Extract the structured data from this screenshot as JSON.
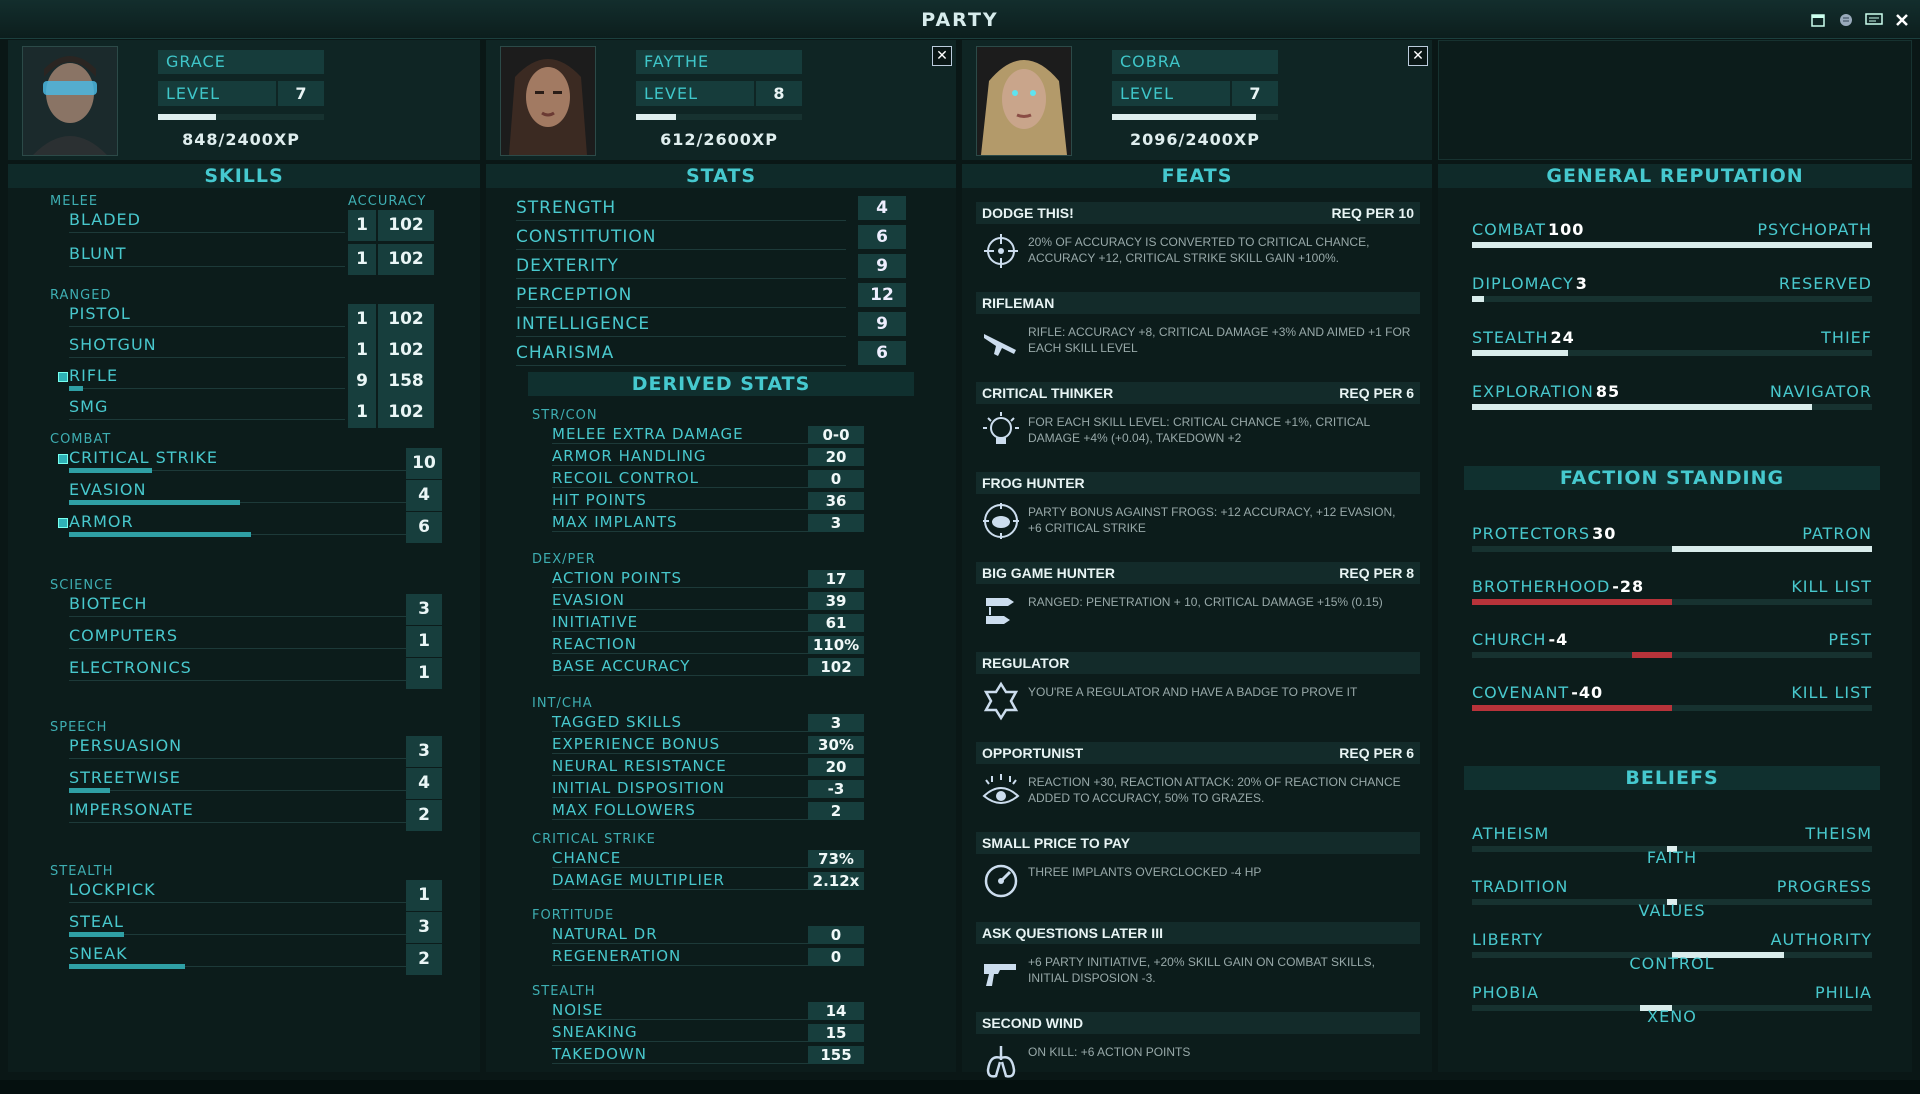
{
  "window": {
    "title": "PARTY"
  },
  "characters": [
    {
      "name": "GRACE",
      "level_label": "LEVEL",
      "level": "7",
      "xp_text": "848/2400XP",
      "xp_progress": 0.35
    },
    {
      "name": "FAYTHE",
      "level_label": "LEVEL",
      "level": "8",
      "xp_text": "612/2600XP",
      "xp_progress": 0.24
    },
    {
      "name": "COBRA",
      "level_label": "LEVEL",
      "level": "7",
      "xp_text": "2096/2400XP",
      "xp_progress": 0.87
    }
  ],
  "skills": {
    "title": "SKILLS",
    "accuracy_label": "ACCURACY",
    "groups": [
      {
        "label": "MELEE",
        "items": [
          {
            "name": "BLADED",
            "rank": "1",
            "accuracy": "102",
            "tagged": false,
            "progress": 0
          },
          {
            "name": "BLUNT",
            "rank": "1",
            "accuracy": "102",
            "tagged": false,
            "progress": 0
          }
        ]
      },
      {
        "label": "RANGED",
        "items": [
          {
            "name": "PISTOL",
            "rank": "1",
            "accuracy": "102",
            "tagged": false,
            "progress": 0
          },
          {
            "name": "SHOTGUN",
            "rank": "1",
            "accuracy": "102",
            "tagged": false,
            "progress": 0
          },
          {
            "name": "RIFLE",
            "rank": "9",
            "accuracy": "158",
            "tagged": true,
            "progress": 0.05
          },
          {
            "name": "SMG",
            "rank": "1",
            "accuracy": "102",
            "tagged": false,
            "progress": 0
          }
        ]
      },
      {
        "label": "COMBAT",
        "items": [
          {
            "name": "CRITICAL STRIKE",
            "value": "10",
            "tagged": true,
            "progress": 0.3
          },
          {
            "name": "EVASION",
            "value": "4",
            "tagged": false,
            "progress": 0.62
          },
          {
            "name": "ARMOR",
            "value": "6",
            "tagged": true,
            "progress": 0.66
          }
        ]
      },
      {
        "label": "SCIENCE",
        "items": [
          {
            "name": "BIOTECH",
            "value": "3",
            "tagged": false,
            "progress": 0
          },
          {
            "name": "COMPUTERS",
            "value": "1",
            "tagged": false,
            "progress": 0
          },
          {
            "name": "ELECTRONICS",
            "value": "1",
            "tagged": false,
            "progress": 0
          }
        ]
      },
      {
        "label": "SPEECH",
        "items": [
          {
            "name": "PERSUASION",
            "value": "3",
            "tagged": false,
            "progress": 0
          },
          {
            "name": "STREETWISE",
            "value": "4",
            "tagged": false,
            "progress": 0.15
          },
          {
            "name": "IMPERSONATE",
            "value": "2",
            "tagged": false,
            "progress": 0
          }
        ]
      },
      {
        "label": "STEALTH",
        "items": [
          {
            "name": "LOCKPICK",
            "value": "1",
            "tagged": false,
            "progress": 0
          },
          {
            "name": "STEAL",
            "value": "3",
            "tagged": false,
            "progress": 0.2
          },
          {
            "name": "SNEAK",
            "value": "2",
            "tagged": false,
            "progress": 0.42
          }
        ]
      }
    ]
  },
  "stats": {
    "title": "STATS",
    "items": [
      {
        "name": "STRENGTH",
        "value": "4"
      },
      {
        "name": "CONSTITUTION",
        "value": "6"
      },
      {
        "name": "DEXTERITY",
        "value": "9"
      },
      {
        "name": "PERCEPTION",
        "value": "12"
      },
      {
        "name": "INTELLIGENCE",
        "value": "9"
      },
      {
        "name": "CHARISMA",
        "value": "6"
      }
    ],
    "derived_title": "DERIVED STATS",
    "derived_groups": [
      {
        "label": "STR/CON",
        "items": [
          {
            "name": "MELEE EXTRA DAMAGE",
            "value": "0-0"
          },
          {
            "name": "ARMOR HANDLING",
            "value": "20"
          },
          {
            "name": "RECOIL CONTROL",
            "value": "0"
          },
          {
            "name": "HIT POINTS",
            "value": "36"
          },
          {
            "name": "MAX IMPLANTS",
            "value": "3"
          }
        ]
      },
      {
        "label": "DEX/PER",
        "items": [
          {
            "name": "ACTION POINTS",
            "value": "17"
          },
          {
            "name": "EVASION",
            "value": "39"
          },
          {
            "name": "INITIATIVE",
            "value": "61"
          },
          {
            "name": "REACTION",
            "value": "110%"
          },
          {
            "name": "BASE ACCURACY",
            "value": "102"
          }
        ]
      },
      {
        "label": "INT/CHA",
        "items": [
          {
            "name": "TAGGED SKILLS",
            "value": "3"
          },
          {
            "name": "EXPERIENCE BONUS",
            "value": "30%"
          },
          {
            "name": "NEURAL RESISTANCE",
            "value": "20"
          },
          {
            "name": "INITIAL DISPOSITION",
            "value": "-3"
          },
          {
            "name": "MAX FOLLOWERS",
            "value": "2"
          }
        ]
      },
      {
        "label": "CRITICAL STRIKE",
        "items": [
          {
            "name": "CHANCE",
            "value": "73%"
          },
          {
            "name": "DAMAGE MULTIPLIER",
            "value": "2.12x"
          }
        ]
      },
      {
        "label": "FORTITUDE",
        "items": [
          {
            "name": "NATURAL DR",
            "value": "0"
          },
          {
            "name": "REGENERATION",
            "value": "0"
          }
        ]
      },
      {
        "label": "STEALTH",
        "items": [
          {
            "name": "NOISE",
            "value": "14"
          },
          {
            "name": "SNEAKING",
            "value": "15"
          },
          {
            "name": "TAKEDOWN",
            "value": "155"
          }
        ]
      }
    ]
  },
  "feats": {
    "title": "FEATS",
    "items": [
      {
        "name": "DODGE THIS!",
        "req": "REQ PER 10",
        "icon": "crosshair-icon",
        "desc": "20% OF ACCURACY IS CONVERTED TO CRITICAL CHANCE, ACCURACY +12, CRITICAL STRIKE SKILL GAIN +100%."
      },
      {
        "name": "RIFLEMAN",
        "req": "",
        "icon": "rifle-icon",
        "desc": "RIFLE: ACCURACY +8, CRITICAL DAMAGE +3% AND AIMED +1 FOR EACH SKILL LEVEL"
      },
      {
        "name": "CRITICAL THINKER",
        "req": "REQ PER 6",
        "icon": "lightbulb-icon",
        "desc": "FOR EACH SKILL LEVEL: CRITICAL CHANCE +1%, CRITICAL DAMAGE +4% (+0.04), TAKEDOWN +2"
      },
      {
        "name": "FROG HUNTER",
        "req": "",
        "icon": "frog-target-icon",
        "desc": "PARTY BONUS AGAINST FROGS: +12 ACCURACY, +12 EVASION, +6 CRITICAL STRIKE"
      },
      {
        "name": "BIG GAME HUNTER",
        "req": "REQ PER 8",
        "icon": "bullets-icon",
        "desc": "RANGED: PENETRATION + 10, CRITICAL DAMAGE +15% (0.15)"
      },
      {
        "name": "REGULATOR",
        "req": "",
        "icon": "badge-icon",
        "desc": "YOU'RE A REGULATOR AND HAVE A BADGE TO PROVE IT"
      },
      {
        "name": "OPPORTUNIST",
        "req": "REQ PER 6",
        "icon": "eye-icon",
        "desc": "REACTION +30, REACTION ATTACK: 20% OF REACTION CHANCE ADDED TO ACCURACY, 50% TO GRAZES."
      },
      {
        "name": "SMALL PRICE TO PAY",
        "req": "",
        "icon": "gauge-icon",
        "desc": "THREE IMPLANTS OVERCLOCKED -4 HP"
      },
      {
        "name": "ASK QUESTIONS LATER III",
        "req": "",
        "icon": "pistol-icon",
        "desc": "+6 PARTY INITIATIVE, +20% SKILL GAIN ON COMBAT SKILLS, INITIAL DISPOSION -3."
      },
      {
        "name": "SECOND WIND",
        "req": "",
        "icon": "lungs-icon",
        "desc": "ON KILL: +6 ACTION POINTS"
      }
    ]
  },
  "reputation": {
    "title": "GENERAL REPUTATION",
    "items": [
      {
        "name": "COMBAT",
        "value": "100",
        "rank": "PSYCHOPATH",
        "level": 1.0
      },
      {
        "name": "DIPLOMACY",
        "value": "3",
        "rank": "RESERVED",
        "level": 0.03
      },
      {
        "name": "STEALTH",
        "value": "24",
        "rank": "THIEF",
        "level": 0.24
      },
      {
        "name": "EXPLORATION",
        "value": "85",
        "rank": "NAVIGATOR",
        "level": 0.85
      }
    ],
    "faction_title": "FACTION STANDING",
    "factions": [
      {
        "name": "PROTECTORS",
        "value": "30",
        "rank": "PATRON",
        "standing": 0.5
      },
      {
        "name": "BROTHERHOOD",
        "value": "-28",
        "rank": "KILL LIST",
        "standing": -0.5
      },
      {
        "name": "CHURCH",
        "value": "-4",
        "rank": "PEST",
        "standing": -0.1
      },
      {
        "name": "COVENANT",
        "value": "-40",
        "rank": "KILL LIST",
        "standing": -0.5
      }
    ],
    "beliefs_title": "BELIEFS",
    "beliefs": [
      {
        "left": "ATHEISM",
        "right": "THEISM",
        "center": "FAITH",
        "position": 0.0
      },
      {
        "left": "TRADITION",
        "right": "PROGRESS",
        "center": "VALUES",
        "position": 0.0
      },
      {
        "left": "LIBERTY",
        "right": "AUTHORITY",
        "center": "CONTROL",
        "position": 0.28
      },
      {
        "left": "PHOBIA",
        "right": "PHILIA",
        "center": "XENO",
        "position": -0.08
      }
    ],
    "colors": {
      "positive": "#d9eceb",
      "negative": "#b8333a"
    }
  }
}
